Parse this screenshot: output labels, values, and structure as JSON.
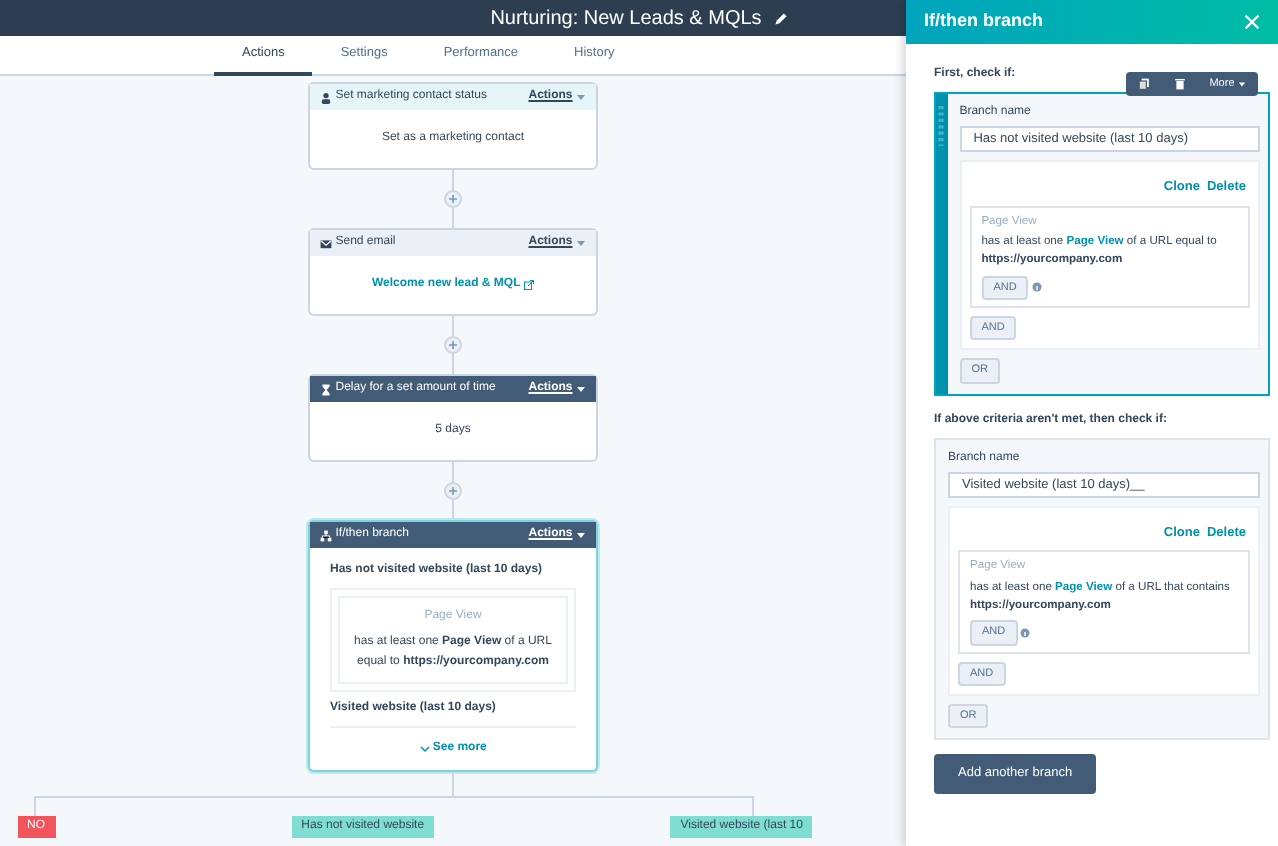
{
  "header": {
    "title": "Nurturing: New Leads & MQLs"
  },
  "tabs": [
    {
      "label": "Actions",
      "selected": true
    },
    {
      "label": "Settings",
      "selected": false
    },
    {
      "label": "Performance",
      "selected": false
    },
    {
      "label": "History",
      "selected": false
    }
  ],
  "actions": [
    {
      "kind": "status",
      "title": "Set marketing contact status",
      "menu": "Actions",
      "body": "Set as a marketing contact"
    },
    {
      "kind": "email",
      "title": "Send email",
      "menu": "Actions",
      "link": "Welcome new lead & MQL"
    },
    {
      "kind": "delay",
      "title": "Delay for a set amount of time",
      "menu": "Actions",
      "body": "5 days"
    },
    {
      "kind": "branch",
      "title": "If/then branch",
      "menu": "Actions",
      "branches": [
        {
          "name": "Has not visited website (last 10 days)",
          "property": "Page View",
          "text": "has at least one **Page View** of a URL equal to **https://yourcompany.com**"
        },
        {
          "name": "Visited website (last 10 days)"
        }
      ],
      "see_more": "See more"
    }
  ],
  "branch_labels": [
    {
      "kind": "no",
      "text": "NO"
    },
    {
      "kind": "branch",
      "text": "Has not visited website"
    },
    {
      "kind": "branch",
      "text": "Visited website (last 10"
    }
  ],
  "panel": {
    "title": "If/then branch",
    "toolbar": {
      "more": "More"
    },
    "branches": [
      {
        "heading": "First, check if:",
        "selected": true,
        "name_label": "Branch name",
        "name_value": "Has not visited website (last 10 days)",
        "clone": "Clone",
        "delete": "Delete",
        "property": "Page View",
        "before": "has at least one",
        "link": "Page View",
        "after": "of a URL equal to",
        "value": "https://yourcompany.com",
        "inner_and": "AND",
        "and": "AND",
        "or": "OR"
      },
      {
        "heading": "If above criteria aren't met, then check if:",
        "selected": false,
        "name_label": "Branch name",
        "name_value": "Visited website (last 10 days)__",
        "clone": "Clone",
        "delete": "Delete",
        "property": "Page View",
        "before": "has at least one",
        "link": "Page View",
        "after": "of a URL that contains",
        "value": "https://yourcompany.com",
        "inner_and": "AND",
        "and": "AND",
        "or": "OR"
      }
    ],
    "add_button": "Add another branch"
  }
}
